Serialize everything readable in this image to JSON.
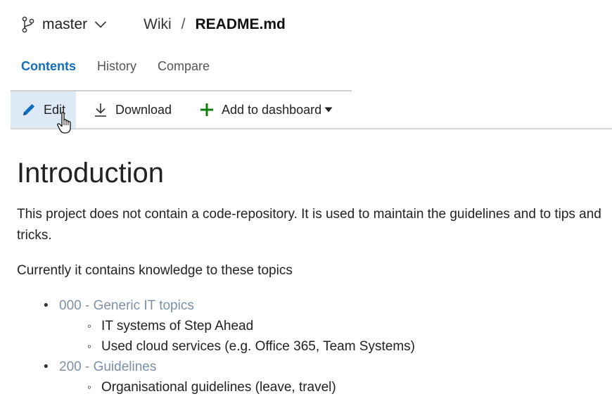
{
  "header": {
    "branch": "master",
    "breadcrumb": {
      "root": "Wiki",
      "separator": "/",
      "file": "README.md"
    }
  },
  "tabs": [
    {
      "label": "Contents",
      "active": true
    },
    {
      "label": "History",
      "active": false
    },
    {
      "label": "Compare",
      "active": false
    }
  ],
  "toolbar": {
    "edit_label": "Edit",
    "download_label": "Download",
    "dashboard_label": "Add to dashboard"
  },
  "content": {
    "heading": "Introduction",
    "paragraph1": "This project does not contain a code-repository. It is used to maintain the guidelines and to tips and tricks.",
    "paragraph2": "Currently it contains knowledge to these topics",
    "topics": [
      {
        "label": "000 - Generic IT topics",
        "items": [
          "IT systems of Step Ahead",
          "Used cloud services (e.g. Office 365, Team Systems)"
        ]
      },
      {
        "label": "200 - Guidelines",
        "items": [
          "Organisational guidelines (leave, travel)"
        ]
      }
    ]
  },
  "colors": {
    "accent": "#106ebe",
    "link": "#7d90a8",
    "edit_highlight": "#dde9f5",
    "add_icon": "#107c10"
  }
}
